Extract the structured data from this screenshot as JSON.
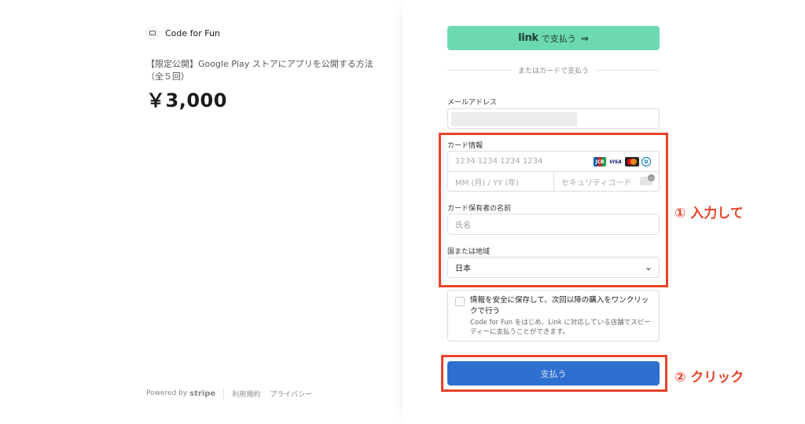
{
  "merchant": {
    "name": "Code for Fun"
  },
  "product": {
    "title": "【限定公開】Google Play ストアにアプリを公開する方法（全５回）",
    "price": "￥3,000"
  },
  "footer": {
    "powered_by": "Powered by",
    "stripe": "stripe",
    "terms": "利用規約",
    "privacy": "プライバシー"
  },
  "checkout": {
    "link_brand": "link",
    "link_button": "で支払う",
    "link_arrow": "⇒",
    "divider": "またはカードで支払う",
    "email_label": "メールアドレス",
    "card_label": "カード情報",
    "card_number_placeholder": "1234 1234 1234 1234",
    "card_brands": [
      "JCB",
      "VISA",
      "",
      "D"
    ],
    "expiry_placeholder": "MM (月) / YY (年)",
    "cvc_placeholder": "セキュリティコード",
    "cardholder_label": "カード保有者の名前",
    "cardholder_placeholder": "氏名",
    "country_label": "国または地域",
    "country_value": "日本",
    "save_title": "情報を安全に保存して、次回以降の購入をワンクリックで行う",
    "save_desc": "Code for Fun をはじめ、Link に対応している店舗でスピーディーに支払うことができます。",
    "pay_button": "支払う",
    "link_color": "#6dd9b1",
    "pay_color": "#2f6fcf"
  },
  "annotations": {
    "step1": "① 入力して",
    "step2": "② クリック",
    "color": "#e8432b"
  }
}
